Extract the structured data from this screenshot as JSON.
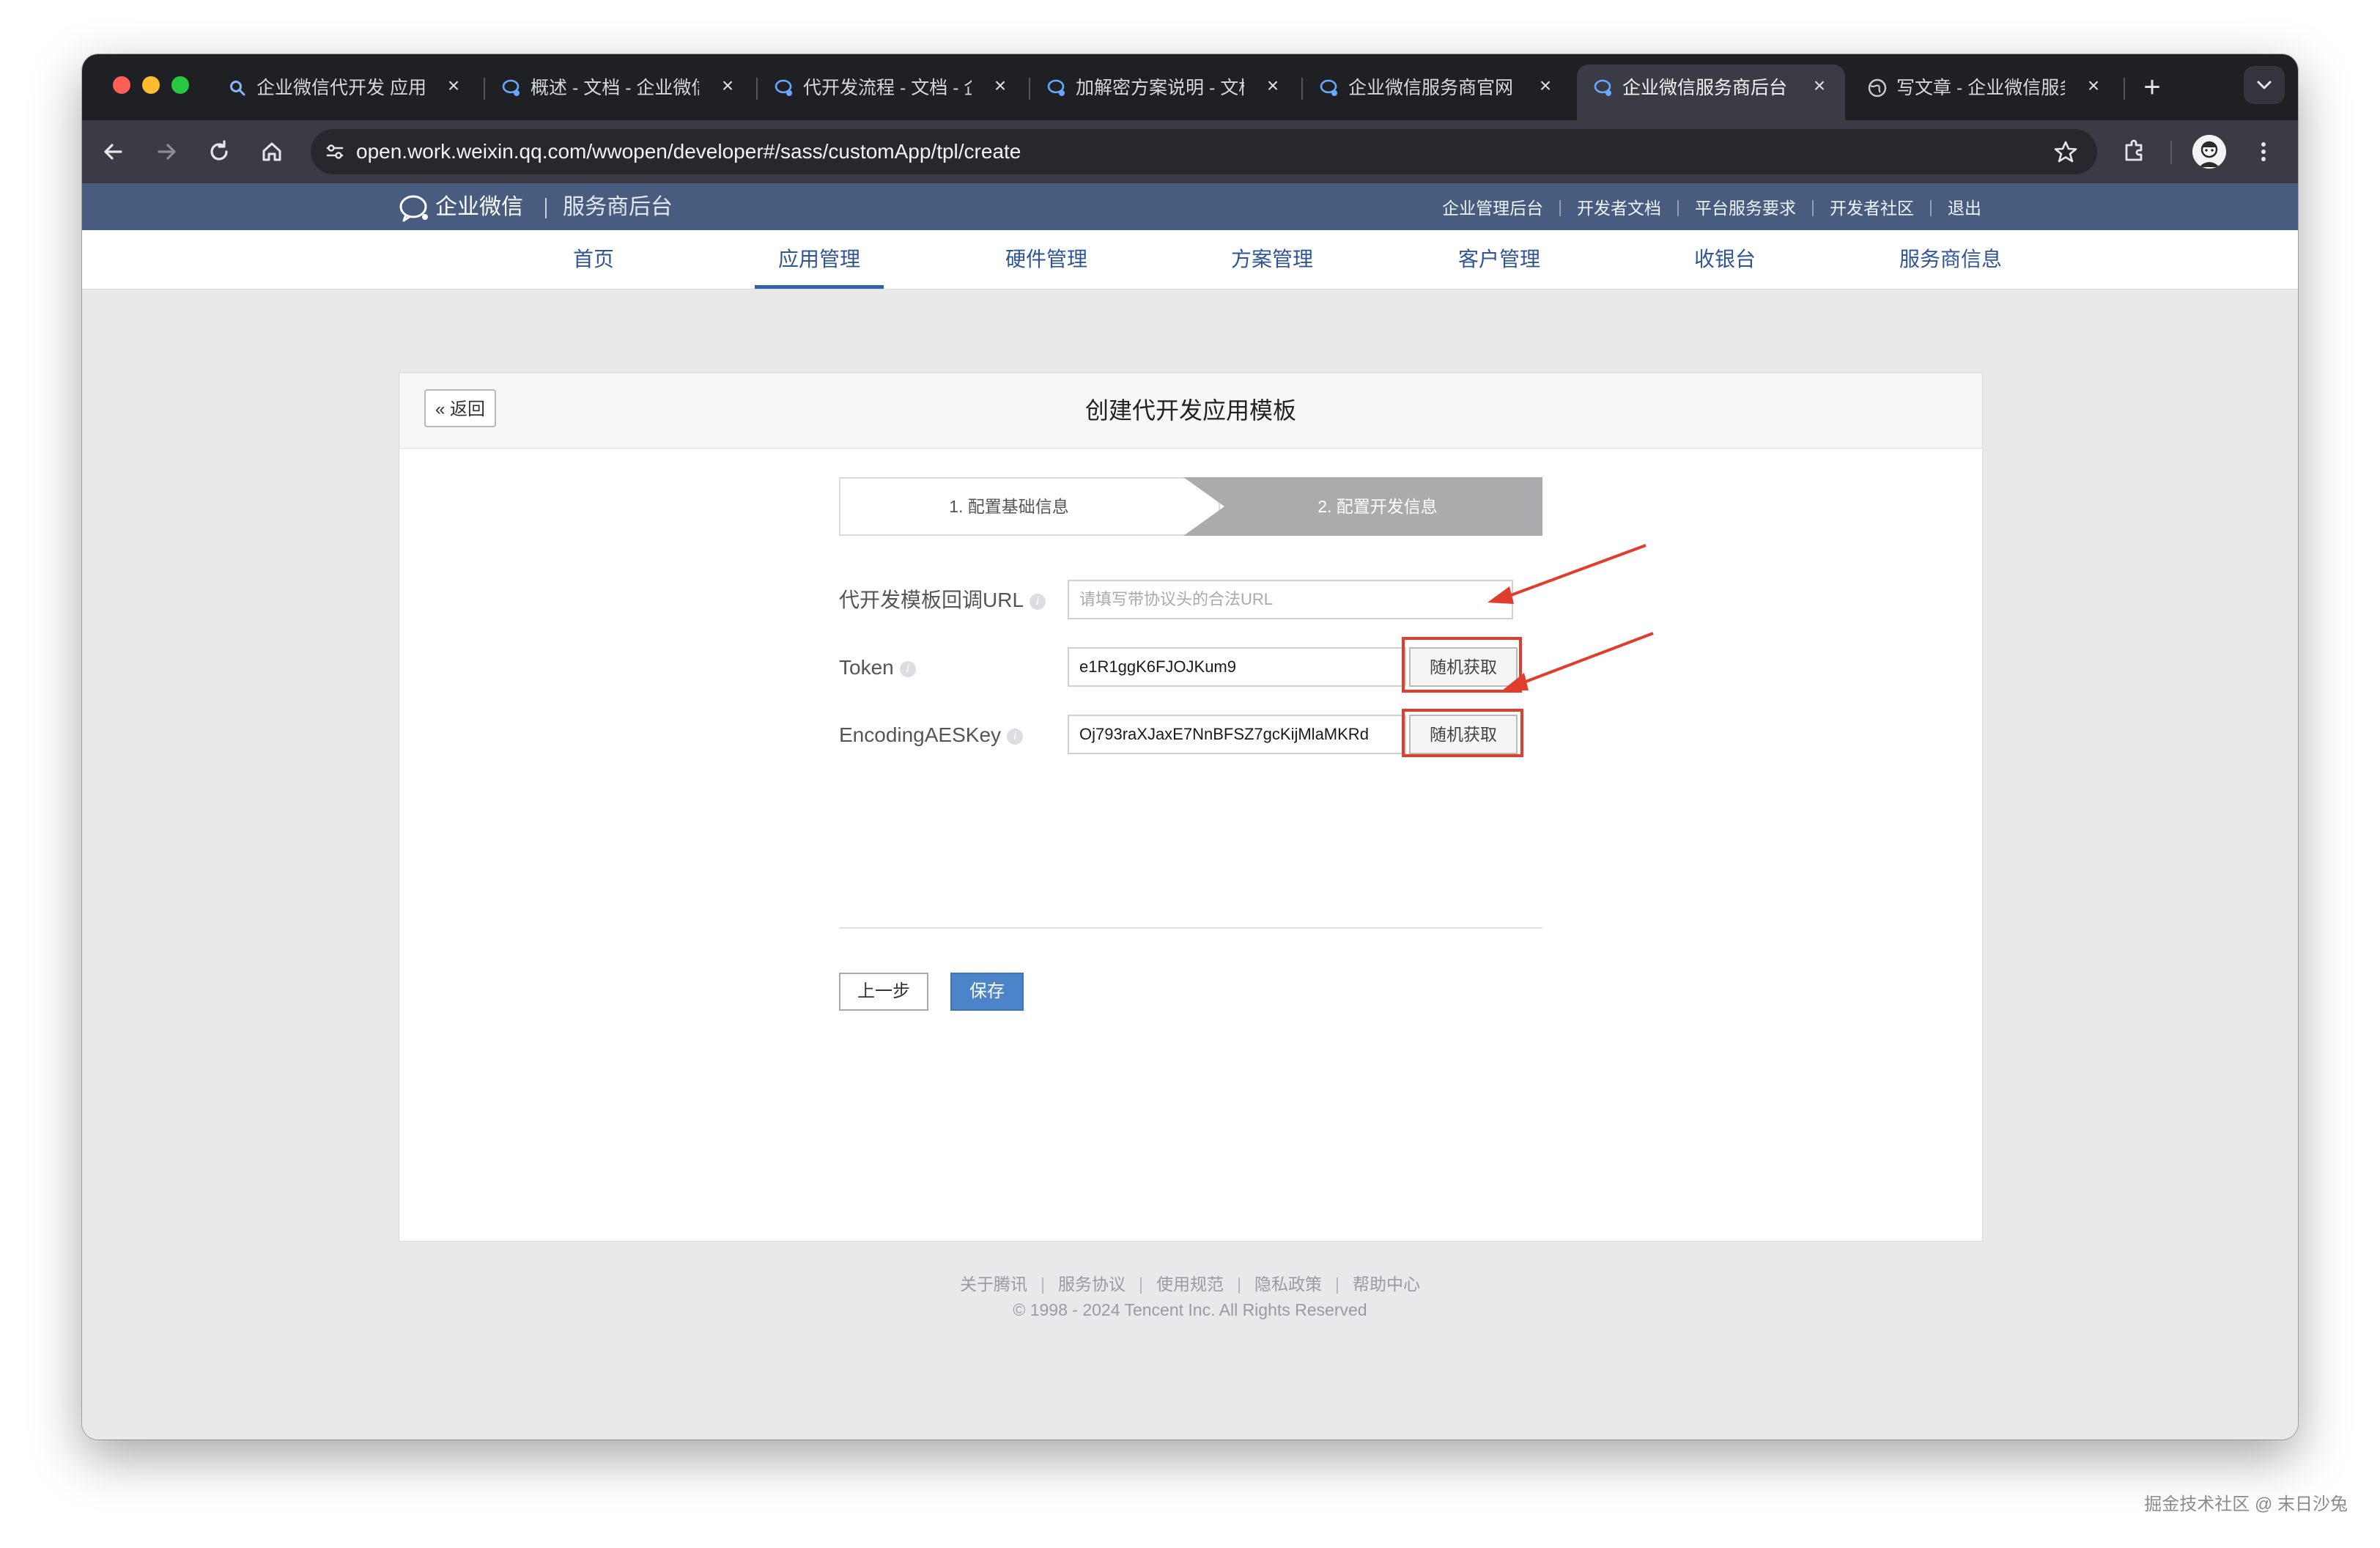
{
  "browser": {
    "tabs": [
      {
        "title": "企业微信代开发 应用…",
        "icon": "search-icon"
      },
      {
        "title": "概述 - 文档 - 企业微信…",
        "icon": "wecom-icon"
      },
      {
        "title": "代开发流程 - 文档 - 企…",
        "icon": "wecom-icon"
      },
      {
        "title": "加解密方案说明 - 文档…",
        "icon": "wecom-icon"
      },
      {
        "title": "企业微信服务商官网",
        "icon": "wecom-icon"
      },
      {
        "title": "企业微信服务商后台",
        "icon": "wecom-icon",
        "active": true
      },
      {
        "title": "写文章 - 企业微信服务…",
        "icon": "globe-icon"
      }
    ],
    "close_glyph": "×",
    "new_tab_glyph": "+",
    "tab_menu_glyph": "⌄",
    "url": "open.work.weixin.qq.com/wwopen/developer#/sass/customApp/tpl/create"
  },
  "site": {
    "brand": "企业微信",
    "subtitle": "服务商后台",
    "top_links": [
      "企业管理后台",
      "开发者文档",
      "平台服务要求",
      "开发者社区",
      "退出"
    ],
    "top_link_separator": "|",
    "nav": [
      "首页",
      "应用管理",
      "硬件管理",
      "方案管理",
      "客户管理",
      "收银台",
      "服务商信息"
    ],
    "active_nav": "应用管理"
  },
  "panel": {
    "back_label": "« 返回",
    "title": "创建代开发应用模板",
    "steps": [
      "1. 配置基础信息",
      "2. 配置开发信息"
    ],
    "active_step": 2,
    "fields": {
      "callback_url": {
        "label": "代开发模板回调URL",
        "placeholder": "请填写带协议头的合法URL",
        "value": ""
      },
      "token": {
        "label": "Token",
        "value": "e1R1ggK6FJOJKum9",
        "button": "随机获取"
      },
      "aes_key": {
        "label": "EncodingAESKey",
        "value": "Oj793raXJaxE7NnBFSZ7gcKijMlaMKRd",
        "button": "随机获取"
      }
    },
    "info_glyph": "i",
    "prev_label": "上一步",
    "save_label": "保存"
  },
  "footer": {
    "links": [
      "关于腾讯",
      "服务协议",
      "使用规范",
      "隐私政策",
      "帮助中心"
    ],
    "link_separator": "|",
    "copyright": "© 1998 - 2024 Tencent Inc. All Rights Reserved"
  },
  "watermark": "掘金技术社区 @ 末日沙兔",
  "colors": {
    "tab_strip": "#1f2024",
    "toolbar": "#3a3b45",
    "site_header": "#475c7e",
    "nav_text": "#2f5597",
    "save_button": "#4b84c8",
    "annotation_red": "#e13d2d"
  }
}
